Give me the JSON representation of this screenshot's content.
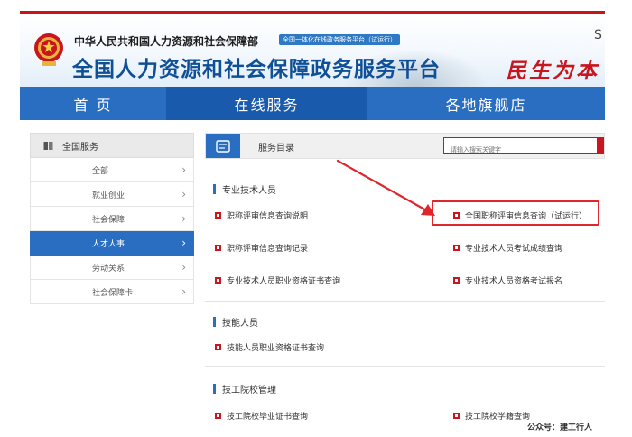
{
  "header": {
    "ministry": "中华人民共和国人力资源和社会保障部",
    "tag": "全国一体化在线政务服务平台（试运行）",
    "platform_title": "全国人力资源和社会保障政务服务平台",
    "slogan": "民生为本",
    "corner_text": "S"
  },
  "nav": {
    "home": "首 页",
    "online": "在线服务",
    "flagship": "各地旗舰店"
  },
  "sidebar": {
    "title": "全国服务",
    "items": [
      {
        "label": "全部"
      },
      {
        "label": "就业创业"
      },
      {
        "label": "社会保障"
      },
      {
        "label": "人才人事"
      },
      {
        "label": "劳动关系"
      },
      {
        "label": "社会保障卡"
      }
    ],
    "active_index": 3
  },
  "catalog": {
    "title": "服务目录",
    "search_placeholder": "请输入搜索关键字"
  },
  "sections": {
    "professional": {
      "title": "专业技术人员",
      "links": [
        "职称评审信息查询说明",
        "全国职称评审信息查询（试运行）",
        "职称评审信息查询记录",
        "专业技术人员考试成绩查询",
        "专业技术人员职业资格证书查询",
        "专业技术人员资格考试报名"
      ]
    },
    "skilled": {
      "title": "技能人员",
      "links": [
        "技能人员职业资格证书查询"
      ]
    },
    "technical_school": {
      "title": "技工院校管理",
      "links": [
        "技工院校毕业证书查询",
        "技工院校学籍查询"
      ]
    }
  },
  "watermark": "公众号：建工行人",
  "colors": {
    "brand_blue": "#2a6ec2",
    "nav_active": "#1a5aad",
    "accent_red": "#c9151e",
    "annotation_red": "#e0262d"
  },
  "icons": {
    "emblem": "national-emblem-icon",
    "book": "book-icon",
    "catalog": "catalog-icon",
    "chevron": "chevron-right-icon",
    "bullet": "square-bullet-icon",
    "arrow": "annotation-arrow-icon"
  }
}
